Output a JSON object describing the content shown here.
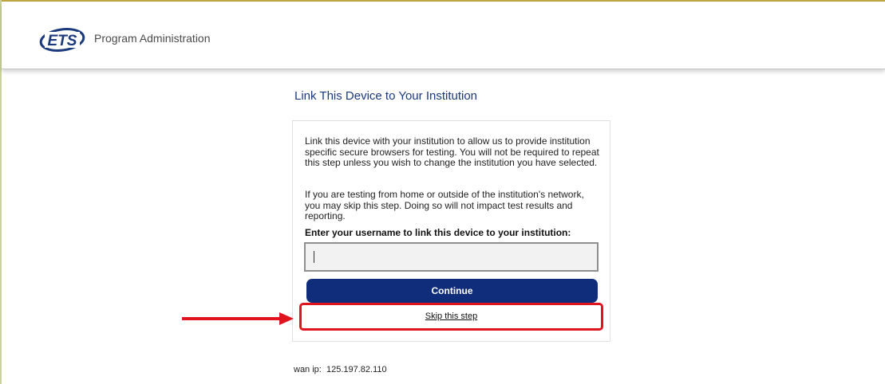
{
  "header": {
    "logo_text": "ETS",
    "app_title": "Program Administration"
  },
  "page": {
    "heading": "Link This Device to Your Institution"
  },
  "card": {
    "paragraph1": "Link this device with your institution to allow us to provide institution specific secure browsers for testing. You will not be required to repeat this step unless you wish to change the institution you have selected.",
    "paragraph2": "If you are testing from home or outside of the institution's network, you may skip this step. Doing so will not impact test results and reporting.",
    "field_label": "Enter your username to link this device to your institution:",
    "username_value": "",
    "continue_label": "Continue",
    "skip_label": "Skip this step"
  },
  "footer": {
    "ip_label": "wan ip:",
    "ip_value": "125.197.82.110"
  },
  "colors": {
    "brand_blue": "#0f2d7a",
    "heading_blue": "#1b3a7c",
    "annotation_red": "#e0141e"
  }
}
